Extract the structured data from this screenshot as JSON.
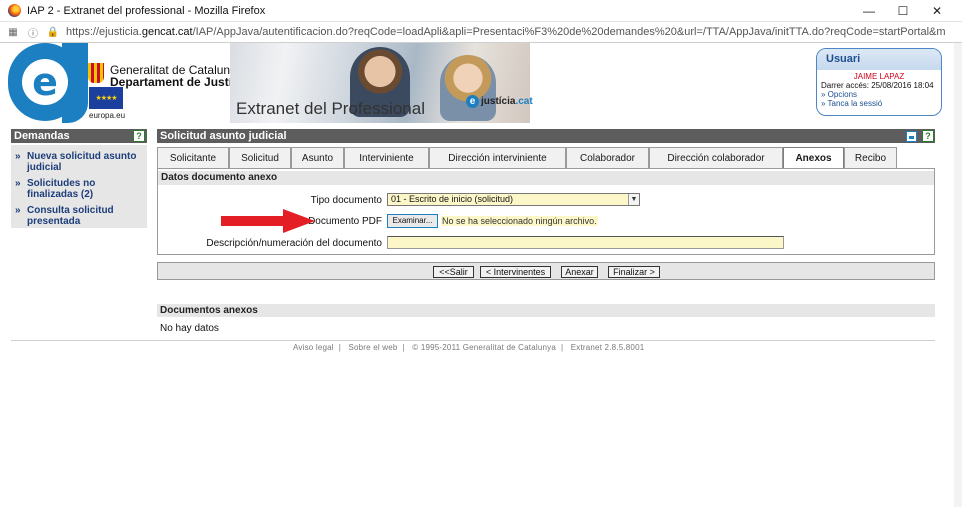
{
  "browser": {
    "title": "IAP 2 - Extranet del professional - Mozilla Firefox",
    "url_prefix": "https://ejusticia.",
    "url_domain": "gencat.cat",
    "url_rest": "/IAP/AppJava/autentificacion.do?reqCode=loadApli&apli=Presentaci%F3%20de%20demandes%20&url=/TTA/AppJava/initTTA.do?reqCode=startPortal&modoIAP=S&set-locale=ca_",
    "min": "—",
    "max": "☐",
    "close": "✕"
  },
  "header": {
    "logo_letter": "e",
    "gen_line1": "Generalitat de Catalunya",
    "gen_line2": "Departament de Justícia",
    "eu_label": "europa.eu",
    "title": "Extranet del Professional",
    "justicia_letter": "e",
    "justicia_word": "justícia",
    "justicia_tld": ".cat"
  },
  "user": {
    "box_title": "Usuari",
    "name": "JAIME LAPAZ",
    "last_access": "Darrer accés: 25/08/2016 18:04",
    "options": "» Opcions",
    "logout": "» Tanca la sessió"
  },
  "sidebar": {
    "title": "Demandas",
    "help": "?",
    "items": [
      {
        "label": "Nueva solicitud asunto judicial"
      },
      {
        "label": "Solicitudes no finalizadas (2)"
      },
      {
        "label": "Consulta solicitud presentada"
      }
    ],
    "bullet": "»"
  },
  "main": {
    "title": "Solicitud asunto judicial",
    "help": "?",
    "tabs": [
      {
        "label": "Solicitante",
        "active": false
      },
      {
        "label": "Solicitud",
        "active": false
      },
      {
        "label": "Asunto",
        "active": false
      },
      {
        "label": "Interviniente",
        "active": false
      },
      {
        "label": "Dirección interviniente",
        "active": false
      },
      {
        "label": "Colaborador",
        "active": false
      },
      {
        "label": "Dirección colaborador",
        "active": false
      },
      {
        "label": "Anexos",
        "active": true
      },
      {
        "label": "Recibo",
        "active": false
      }
    ],
    "section_title": "Datos documento anexo",
    "tipo_label": "Tipo documento",
    "tipo_value": "01 - Escrito de inicio (solicitud)",
    "pdf_label": "Documento PDF",
    "file_button": "Examinar...",
    "file_status": "No se ha seleccionado ningún archivo.",
    "desc_label": "Descripción/numeración del documento",
    "desc_value": ""
  },
  "actions": {
    "salir": "<<Salir",
    "intervinientes": "< Intervinentes",
    "anexar": "Anexar",
    "finalizar": "Finalizar >"
  },
  "attachments": {
    "title": "Documentos anexos",
    "empty": "No hay datos"
  },
  "footer": {
    "legal": "Aviso legal",
    "about": "Sobre el web",
    "copyright": "© 1995-2011 Generalitat de Catalunya",
    "version": "Extranet 2.8.5.8001"
  },
  "colors": {
    "accent_blue": "#1c7fc1",
    "header_gray": "#5d5d5d",
    "field_yellow": "#fcf7c8",
    "annotation_red": "#e31e24"
  }
}
